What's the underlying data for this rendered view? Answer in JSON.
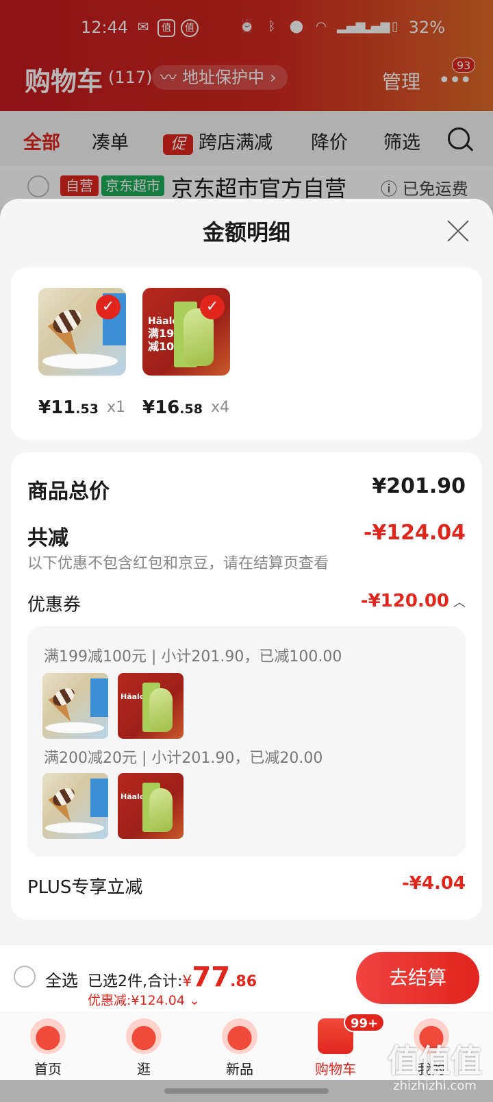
{
  "status_bar": {
    "time": "12:44",
    "battery_pct": "32%",
    "app_icon_a": "值",
    "app_icon_b": "值"
  },
  "cart_header": {
    "title": "购物车",
    "count": "(117)",
    "address_label": "地址保护中",
    "manage_label": "管理",
    "more_badge": "93"
  },
  "filter_tabs": [
    {
      "label": "全部"
    },
    {
      "label": "凑单"
    },
    {
      "label": "跨店满减",
      "tag": "促"
    },
    {
      "label": "降价"
    },
    {
      "label": "筛选"
    }
  ],
  "store": {
    "self_tag": "自营",
    "super_tag": "京东超市",
    "name": "京东超市官方自营",
    "shipping": "已免运费"
  },
  "sheet": {
    "title": "金额明细",
    "items": [
      {
        "price_int": "¥11",
        "price_dec": ".53",
        "qty": "x1"
      },
      {
        "price_int": "¥16",
        "price_dec": ".58",
        "qty": "x4",
        "brand": "Häalo",
        "promo": "满199\n减100"
      }
    ],
    "total_label": "商品总价",
    "total_value": "¥201.90",
    "reduce_label": "共减",
    "reduce_value": "-¥124.04",
    "reduce_note": "以下优惠不包含红包和京豆，请在结算页查看",
    "coupon_label": "优惠券",
    "coupon_value": "-¥120.00",
    "coupons": [
      {
        "text": "满199减100元 | 小计201.90，已减100.00"
      },
      {
        "text": "满200减20元 | 小计201.90，已减20.00"
      }
    ],
    "plus_label": "PLUS专享立减",
    "plus_value": "-¥4.04"
  },
  "checkout": {
    "select_all": "全选",
    "selected_text": "已选2件,合计:",
    "currency": "¥",
    "total_int": "77",
    "total_dec": ".86",
    "discount_text": "优惠减:¥124.04",
    "button": "去结算"
  },
  "tabbar": [
    {
      "label": "首页"
    },
    {
      "label": "逛"
    },
    {
      "label": "新品"
    },
    {
      "label": "购物车",
      "badge": "99+"
    },
    {
      "label": "我的"
    }
  ],
  "watermark": {
    "mark": "值",
    "text": "zhizhizhi.com"
  },
  "colors": {
    "brand_red": "#e0251d",
    "header_red": "#c61a1e",
    "discount_green": "#1fae5a"
  }
}
